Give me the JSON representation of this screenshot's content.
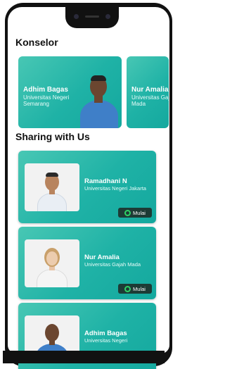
{
  "sections": {
    "konselor_title": "Konselor",
    "sharing_title": "Sharing with Us"
  },
  "counselors": [
    {
      "name": "Adhim Bagas",
      "university": "Universitas Negeri Semarang"
    },
    {
      "name": "Nur Amalia",
      "university": "Universitas Gajah Mada"
    }
  ],
  "sharing": [
    {
      "name": "Ramadhani N",
      "university": "Universitas Negeri Jakarta",
      "button": "Mulai"
    },
    {
      "name": "Nur Amalia",
      "university": "Universitas Gajah Mada",
      "button": "Mulai"
    },
    {
      "name": "Adhim Bagas",
      "university": "Universitas Negeri"
    }
  ],
  "colors": {
    "accent": "#1fb2a6",
    "button_bg": "#1d3b35",
    "whatsapp": "#2fd366"
  },
  "icons": {
    "mulai_icon": "whatsapp-icon"
  }
}
